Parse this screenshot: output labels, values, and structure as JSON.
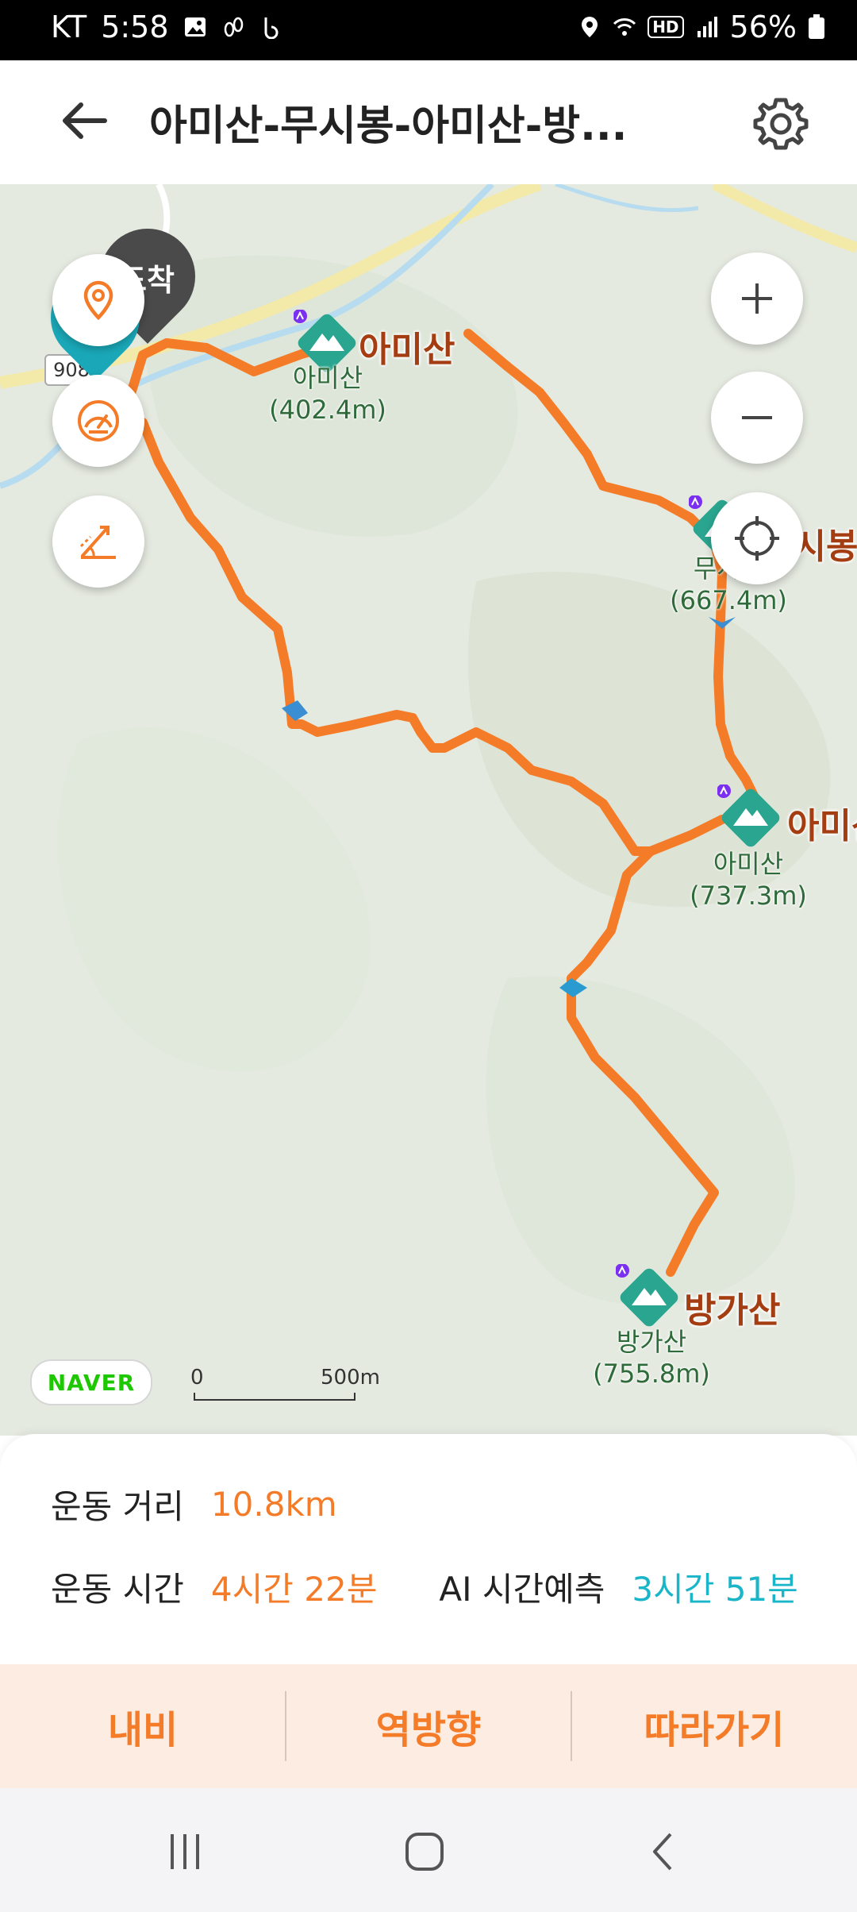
{
  "status_bar": {
    "carrier": "KT",
    "time": "5:58",
    "hd_label": "HD",
    "battery": "56%"
  },
  "header": {
    "title": "아미산-무시봉-아미산-방..."
  },
  "map": {
    "road_number": "908",
    "arrival_label": "도착",
    "peaks": [
      {
        "name": "아미산",
        "label": "아미산",
        "elevation": "(402.4m)"
      },
      {
        "name": "무시봉",
        "label": "무시봉",
        "elevation": "(667.4m)"
      },
      {
        "name": "아미산",
        "label": "아미산",
        "elevation": "(737.3m)"
      },
      {
        "name": "방가산",
        "label": "방가산",
        "elevation": "(755.8m)"
      }
    ],
    "provider": "NAVER",
    "scale": {
      "start": "0",
      "end": "500m"
    }
  },
  "stats": {
    "distance_label": "운동 거리",
    "distance_value": "10.8km",
    "time_label": "운동 시간",
    "time_value": "4시간 22분",
    "ai_label": "AI 시간예측",
    "ai_value": "3시간 51분"
  },
  "actions": {
    "navi": "내비",
    "reverse": "역방향",
    "follow": "따라가기"
  },
  "colors": {
    "route": "#f47b27",
    "accent_blue": "#1ab5c9",
    "peak_icon": "#2aa58f",
    "peak_label": "#a43d12"
  }
}
